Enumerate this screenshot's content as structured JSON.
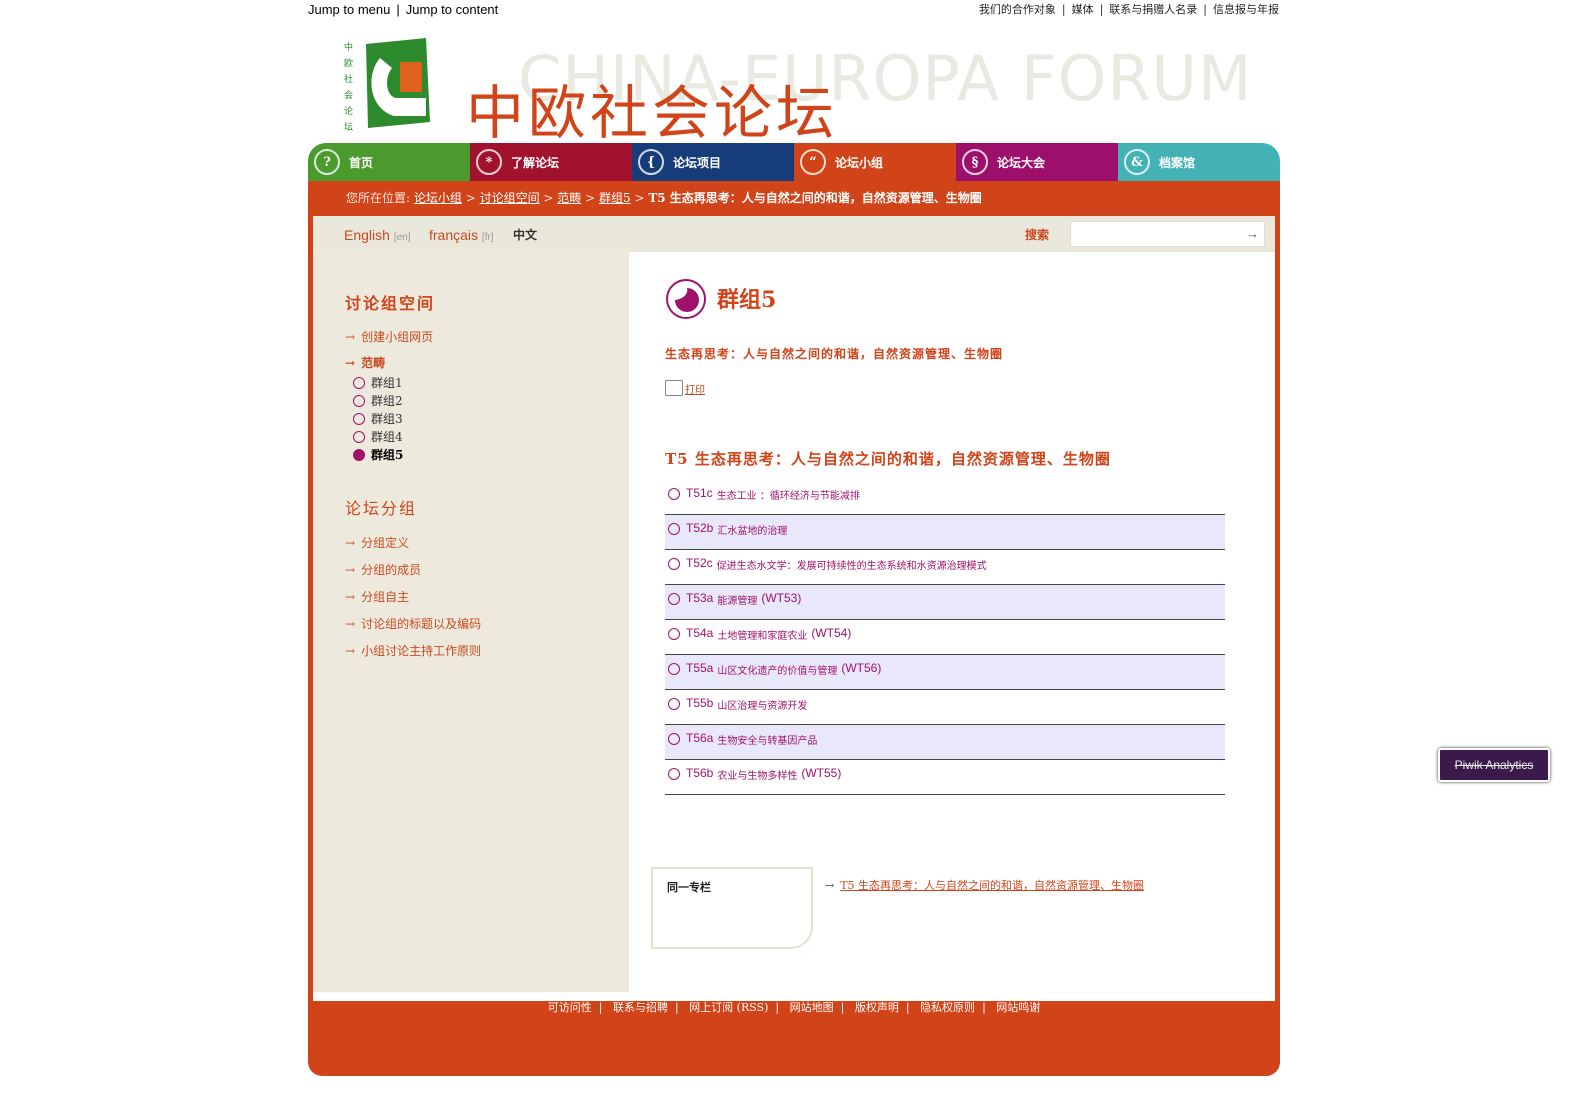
{
  "skip_links": [
    "Jump to menu",
    "Jump to content"
  ],
  "top_links": [
    "我们的合作对象",
    "媒体",
    "联系与捐赠人名录",
    "信息报与年报"
  ],
  "logo": {
    "title": "中欧社会论坛",
    "watermark": "CHINA-EUROPA FORUM",
    "vertical_text": "中欧社会论坛"
  },
  "nav": [
    {
      "label": "首页",
      "icon": "?",
      "color": "#4a9a2e"
    },
    {
      "label": "了解论坛",
      "icon": "*",
      "color": "#a0122e"
    },
    {
      "label": "论坛项目",
      "icon": "{",
      "color": "#173c7a"
    },
    {
      "label": "论坛小组",
      "icon": "“",
      "color": "#d1441a"
    },
    {
      "label": "论坛大会",
      "icon": "§",
      "color": "#9c0f6a"
    },
    {
      "label": "档案馆",
      "icon": "&",
      "color": "#43b2b5"
    }
  ],
  "breadcrumb": {
    "prefix": "您所在位置:",
    "items": [
      "论坛小组",
      "讨论组空间",
      "范畴",
      "群组5"
    ],
    "current": "T5 生态再思考：人与自然之间的和谐，自然资源管理、生物圈"
  },
  "languages": [
    {
      "name": "English",
      "code": "[en]"
    },
    {
      "name": "français",
      "code": "[fr]"
    },
    {
      "name": "中文",
      "code": ""
    }
  ],
  "search": {
    "label": "搜索",
    "placeholder": "",
    "button": "→"
  },
  "sidebar": {
    "heading1": "讨论组空间",
    "links1": [
      "创建小组网页",
      "范畴"
    ],
    "sub_items": [
      "群组1",
      "群组2",
      "群组3",
      "群组4",
      "群组5"
    ],
    "heading2": "论坛分组",
    "links2": [
      "分组定义",
      "分组的成员",
      "分组自主",
      "讨论组的标题以及编码",
      "小组讨论主持工作原则"
    ]
  },
  "main": {
    "group_title": "群组5",
    "subtitle": "生态再思考：人与自然之间的和谐，自然资源管理、生物圈",
    "print": "打印",
    "section_title": "T5 生态再思考：人与自然之间的和谐，自然资源管理、生物圈",
    "rows": [
      {
        "code": "T51c",
        "text": "生态工业 ：循环经济与节能减排",
        "wt": ""
      },
      {
        "code": "T52b",
        "text": "汇水盆地的治理",
        "wt": ""
      },
      {
        "code": "T52c",
        "text": "促进生态水文学：发展可持续性的生态系统和水资源治理模式",
        "wt": ""
      },
      {
        "code": "T53a",
        "text": "能源管理",
        "wt": "(WT53)"
      },
      {
        "code": "T54a",
        "text": "土地管理和家庭农业",
        "wt": "(WT54)"
      },
      {
        "code": "T55a",
        "text": "山区文化遗产的价值与管理",
        "wt": "(WT56)"
      },
      {
        "code": "T55b",
        "text": "山区治理与资源开发",
        "wt": ""
      },
      {
        "code": "T56a",
        "text": "生物安全与转基因产品",
        "wt": ""
      },
      {
        "code": "T56b",
        "text": "农业与生物多样性",
        "wt": "(WT55)"
      }
    ],
    "same_topic_label": "同一专栏",
    "same_topic_link": "T5 生态再思考：人与自然之间的和谐，自然资源管理、生物圈"
  },
  "footer": [
    "可访问性",
    "联系与招聘",
    "网上订阅 (RSS)",
    "网站地图",
    "版权声明",
    "隐私权原则",
    "网站鸣谢"
  ],
  "piwik": "Piwik Analytics"
}
